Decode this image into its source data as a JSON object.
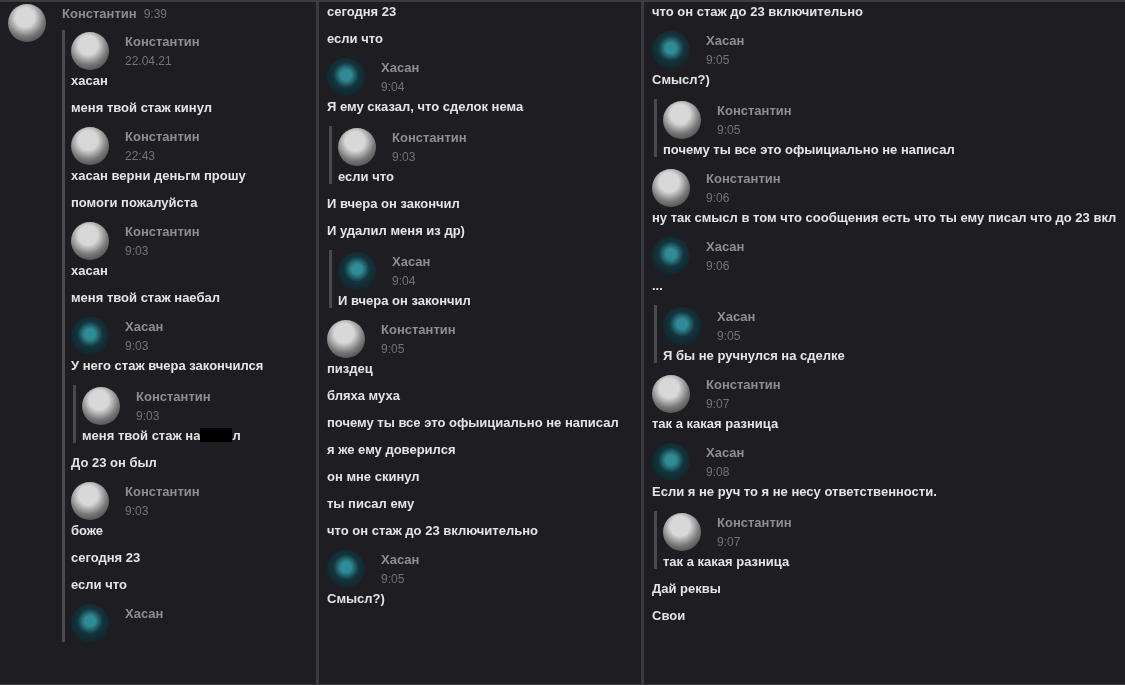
{
  "panels": [
    {
      "items": [
        {
          "kind": "post",
          "author": "Константин",
          "time": "9:39",
          "photo_avatar": true,
          "items": [
            {
              "kind": "quote",
              "items": [
                {
                  "kind": "header",
                  "author": "Константин",
                  "time": "22.04.21",
                  "photo_avatar": true
                },
                {
                  "kind": "text",
                  "text": "хасан"
                },
                {
                  "kind": "text",
                  "text": "меня твой стаж кинул"
                },
                {
                  "kind": "header",
                  "author": "Константин",
                  "time": "22:43",
                  "photo_avatar": true
                },
                {
                  "kind": "text",
                  "text": "хасан верни деньгм прошу"
                },
                {
                  "kind": "text",
                  "text": "помоги пожалуйста"
                },
                {
                  "kind": "header",
                  "author": "Константин",
                  "time": "9:03",
                  "photo_avatar": true
                },
                {
                  "kind": "text",
                  "text": "хасан"
                },
                {
                  "kind": "text",
                  "text": "меня твой стаж наебал"
                },
                {
                  "kind": "header",
                  "author": "Хасан",
                  "time": "9:03",
                  "photo_avatar": false
                },
                {
                  "kind": "text",
                  "text": "У него стаж вчера закончился"
                },
                {
                  "kind": "quote",
                  "items": [
                    {
                      "kind": "header",
                      "author": "Константин",
                      "time": "9:03",
                      "photo_avatar": true
                    },
                    {
                      "kind": "redacted",
                      "before": "меня твой стаж на",
                      "after": "л"
                    }
                  ]
                },
                {
                  "kind": "text",
                  "text": "До 23 он был"
                },
                {
                  "kind": "header",
                  "author": "Константин",
                  "time": "9:03",
                  "photo_avatar": true
                },
                {
                  "kind": "text",
                  "text": "боже"
                },
                {
                  "kind": "text",
                  "text": "сегодня 23"
                },
                {
                  "kind": "text",
                  "text": "если что"
                },
                {
                  "kind": "header",
                  "author": "Хасан",
                  "photo_avatar": false
                }
              ]
            }
          ]
        }
      ]
    },
    {
      "items": [
        {
          "kind": "text",
          "text": "сегодня 23"
        },
        {
          "kind": "text",
          "text": "если что"
        },
        {
          "kind": "header",
          "author": "Хасан",
          "time": "9:04",
          "photo_avatar": false
        },
        {
          "kind": "text",
          "text": "Я ему сказал, что сделок нема"
        },
        {
          "kind": "quote",
          "items": [
            {
              "kind": "header",
              "author": "Константин",
              "time": "9:03",
              "photo_avatar": true
            },
            {
              "kind": "text",
              "text": "если что"
            }
          ]
        },
        {
          "kind": "text",
          "text": "И вчера он закончил"
        },
        {
          "kind": "text",
          "text": "И удалил меня из др)"
        },
        {
          "kind": "quote",
          "items": [
            {
              "kind": "header",
              "author": "Хасан",
              "time": "9:04",
              "photo_avatar": false
            },
            {
              "kind": "text",
              "text": "И вчера он закончил"
            }
          ]
        },
        {
          "kind": "header",
          "author": "Константин",
          "time": "9:05",
          "photo_avatar": true
        },
        {
          "kind": "text",
          "text": "пиздец"
        },
        {
          "kind": "text",
          "text": "бляха муха"
        },
        {
          "kind": "text",
          "text": "почему ты все это офыициально не написал"
        },
        {
          "kind": "text",
          "text": "я же ему доверился"
        },
        {
          "kind": "text",
          "text": "он мне скинул"
        },
        {
          "kind": "text",
          "text": "ты писал ему"
        },
        {
          "kind": "text",
          "text": "что он стаж до 23 включительно"
        },
        {
          "kind": "header",
          "author": "Хасан",
          "time": "9:05",
          "photo_avatar": false
        },
        {
          "kind": "text",
          "text": "Смысл?)"
        }
      ]
    },
    {
      "items": [
        {
          "kind": "text",
          "text": "что он стаж до 23 включительно"
        },
        {
          "kind": "header",
          "author": "Хасан",
          "time": "9:05",
          "photo_avatar": false
        },
        {
          "kind": "text",
          "text": "Смысл?)"
        },
        {
          "kind": "quote",
          "items": [
            {
              "kind": "header",
              "author": "Константин",
              "time": "9:05",
              "photo_avatar": true
            },
            {
              "kind": "text",
              "text": "почему ты все это офыициально не написал"
            }
          ]
        },
        {
          "kind": "header",
          "author": "Константин",
          "time": "9:06",
          "photo_avatar": true
        },
        {
          "kind": "text",
          "text": "ну так смысл в том что сообщения есть что ты ему писал что до 23 вкл"
        },
        {
          "kind": "header",
          "author": "Хасан",
          "time": "9:06",
          "photo_avatar": false
        },
        {
          "kind": "text",
          "text": "..."
        },
        {
          "kind": "quote",
          "items": [
            {
              "kind": "header",
              "author": "Хасан",
              "time": "9:05",
              "photo_avatar": false
            },
            {
              "kind": "text",
              "text": "Я бы не ручнулся на сделке"
            }
          ]
        },
        {
          "kind": "header",
          "author": "Константин",
          "time": "9:07",
          "photo_avatar": true
        },
        {
          "kind": "text",
          "text": "так а какая разница"
        },
        {
          "kind": "header",
          "author": "Хасан",
          "time": "9:08",
          "photo_avatar": false
        },
        {
          "kind": "text",
          "text": "Если я не руч то я не несу ответственности."
        },
        {
          "kind": "quote",
          "items": [
            {
              "kind": "header",
              "author": "Константин",
              "time": "9:07",
              "photo_avatar": true
            },
            {
              "kind": "text",
              "text": "так а какая разница"
            }
          ]
        },
        {
          "kind": "text",
          "text": "Дай реквы"
        },
        {
          "kind": "text",
          "text": "Свои"
        }
      ]
    }
  ]
}
